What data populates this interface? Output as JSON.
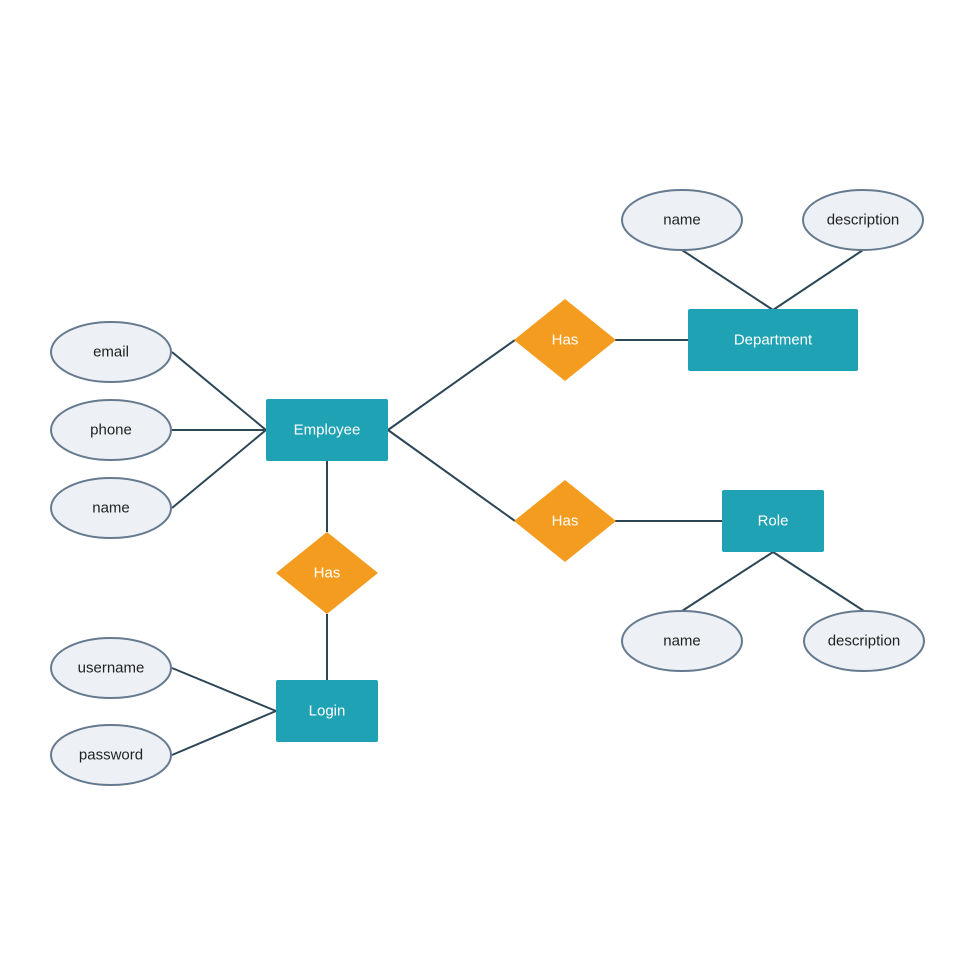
{
  "colors": {
    "entity": "#1fa2b4",
    "relationship": "#f39c1f",
    "attribute_fill": "#edf1f5",
    "attribute_stroke": "#667a8f",
    "line": "#2c4656",
    "entity_text": "#ffffff",
    "attribute_text": "#222222"
  },
  "entities": [
    {
      "id": "employee",
      "label": "Employee"
    },
    {
      "id": "department",
      "label": "Department"
    },
    {
      "id": "role",
      "label": "Role"
    },
    {
      "id": "login",
      "label": "Login"
    }
  ],
  "relationships": [
    {
      "id": "has_dept",
      "label": "Has"
    },
    {
      "id": "has_role",
      "label": "Has"
    },
    {
      "id": "has_login",
      "label": "Has"
    }
  ],
  "attributes": [
    {
      "id": "emp_email",
      "label": "email",
      "of": "employee"
    },
    {
      "id": "emp_phone",
      "label": "phone",
      "of": "employee"
    },
    {
      "id": "emp_name",
      "label": "name",
      "of": "employee"
    },
    {
      "id": "dept_name",
      "label": "name",
      "of": "department"
    },
    {
      "id": "dept_desc",
      "label": "description",
      "of": "department"
    },
    {
      "id": "role_name",
      "label": "name",
      "of": "role"
    },
    {
      "id": "role_desc",
      "label": "description",
      "of": "role"
    },
    {
      "id": "login_user",
      "label": "username",
      "of": "login"
    },
    {
      "id": "login_pass",
      "label": "password",
      "of": "login"
    }
  ],
  "links": [
    [
      "employee",
      "has_dept"
    ],
    [
      "has_dept",
      "department"
    ],
    [
      "employee",
      "has_role"
    ],
    [
      "has_role",
      "role"
    ],
    [
      "employee",
      "has_login"
    ],
    [
      "has_login",
      "login"
    ]
  ]
}
